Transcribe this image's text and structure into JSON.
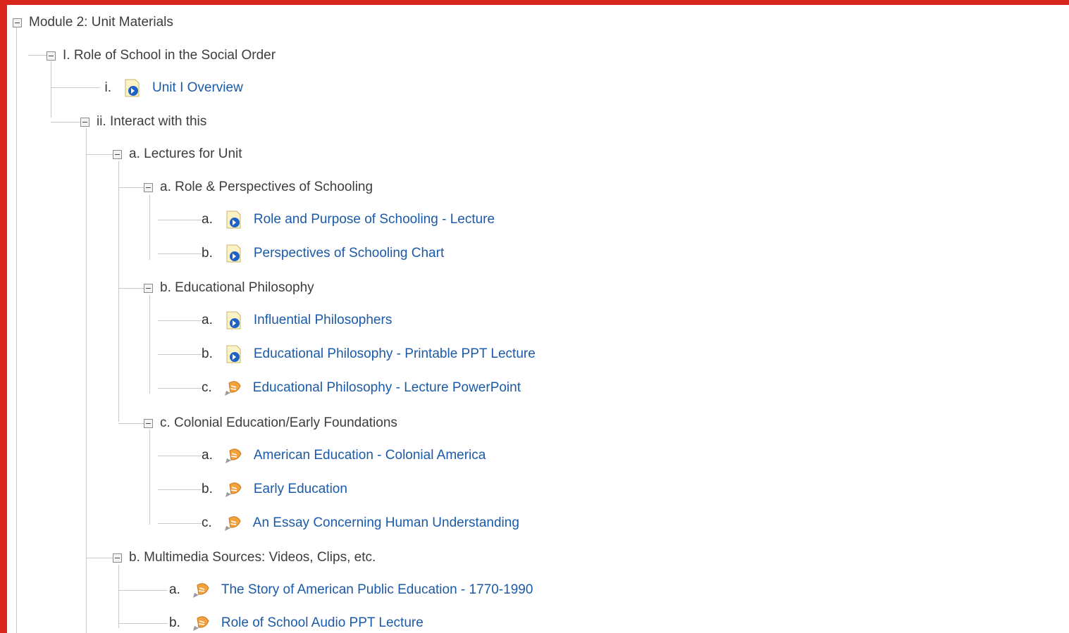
{
  "tree": {
    "module": {
      "toggle": "−",
      "label": "Module 2: Unit Materials"
    },
    "unit_i": {
      "label": "I. Role of School in the Social Order"
    },
    "overview": {
      "num": "i.",
      "label": "Unit I Overview"
    },
    "interact": {
      "label": "ii. Interact with this"
    },
    "lectures": {
      "label": "a. Lectures for Unit"
    },
    "role_persp": {
      "label": "a. Role & Perspectives of Schooling"
    },
    "role_persp_items": [
      {
        "num": "a.",
        "label": "Role and Purpose of Schooling - Lecture",
        "icon": "page-link-icon"
      },
      {
        "num": "b.",
        "label": "Perspectives of Schooling Chart",
        "icon": "page-link-icon"
      }
    ],
    "ed_phil": {
      "label": "b. Educational Philosophy"
    },
    "ed_phil_items": [
      {
        "num": "a.",
        "label": "Influential Philosophers",
        "icon": "page-link-icon"
      },
      {
        "num": "b.",
        "label": "Educational Philosophy - Printable PPT Lecture",
        "icon": "page-link-icon"
      },
      {
        "num": "c.",
        "label": "Educational Philosophy - Lecture PowerPoint",
        "icon": "media-icon"
      }
    ],
    "colonial": {
      "label": "c. Colonial Education/Early Foundations"
    },
    "colonial_items": [
      {
        "num": "a.",
        "label": "American Education - Colonial America",
        "icon": "media-icon"
      },
      {
        "num": "b.",
        "label": "Early Education",
        "icon": "media-icon"
      },
      {
        "num": "c.",
        "label": "An Essay Concerning Human Understanding",
        "icon": "media-icon"
      }
    ],
    "multimedia": {
      "label": "b. Multimedia Sources: Videos, Clips, etc."
    },
    "multimedia_items": [
      {
        "num": "a.",
        "label": "The Story of American Public Education - 1770-1990",
        "icon": "media-icon"
      },
      {
        "num": "b.",
        "label": "Role of School Audio PPT Lecture",
        "icon": "media-icon"
      }
    ]
  },
  "colors": {
    "frame": "#d9261c",
    "link": "#1b5aa8",
    "text": "#3d3d3d"
  }
}
